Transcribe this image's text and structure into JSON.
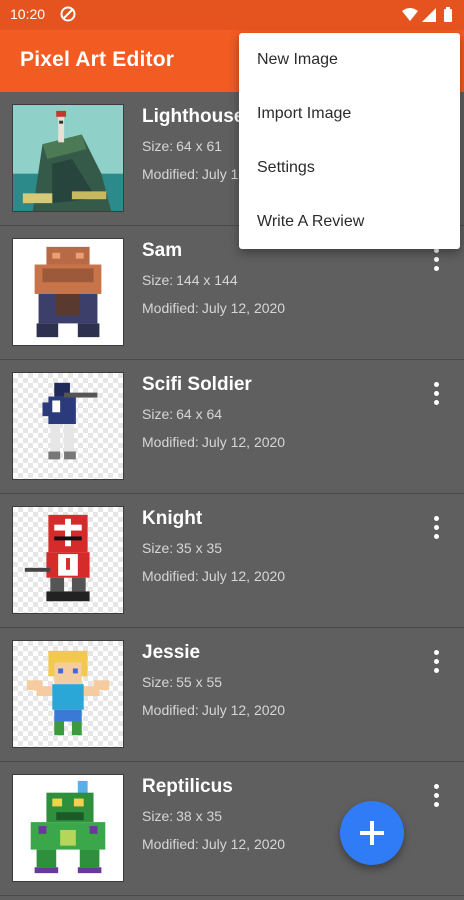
{
  "status_bar": {
    "time": "10:20",
    "icons": [
      "do-not-disturb-icon",
      "wifi-icon",
      "cell-signal-icon",
      "battery-icon"
    ]
  },
  "app_bar": {
    "title": "Pixel Art Editor",
    "color": "#f25b22"
  },
  "menu": {
    "items": [
      {
        "label": "New Image"
      },
      {
        "label": "Import Image"
      },
      {
        "label": "Settings"
      },
      {
        "label": "Write A Review"
      }
    ]
  },
  "list": {
    "items": [
      {
        "name": "Lighthouse",
        "size_label": "Size:",
        "size": "64 x 61",
        "modified_label": "Modified:",
        "modified": "July 12, 2020",
        "icon": "lighthouse-pixel-art"
      },
      {
        "name": "Sam",
        "size_label": "Size:",
        "size": "144 x 144",
        "modified_label": "Modified:",
        "modified": "July 12, 2020",
        "icon": "robot-pixel-art"
      },
      {
        "name": "Scifi Soldier",
        "size_label": "Size:",
        "size": "64 x 64",
        "modified_label": "Modified:",
        "modified": "July 12, 2020",
        "icon": "soldier-pixel-art"
      },
      {
        "name": "Knight",
        "size_label": "Size:",
        "size": "35 x 35",
        "modified_label": "Modified:",
        "modified": "July 12, 2020",
        "icon": "knight-pixel-art"
      },
      {
        "name": "Jessie",
        "size_label": "Size:",
        "size": "55 x 55",
        "modified_label": "Modified:",
        "modified": "July 12, 2020",
        "icon": "girl-pixel-art"
      },
      {
        "name": "Reptilicus",
        "size_label": "Size:",
        "size": "38 x 35",
        "modified_label": "Modified:",
        "modified": "July 12, 2020",
        "icon": "dragon-pixel-art"
      }
    ]
  },
  "fab": {
    "icon": "plus-icon",
    "color": "#2f7cf6"
  }
}
